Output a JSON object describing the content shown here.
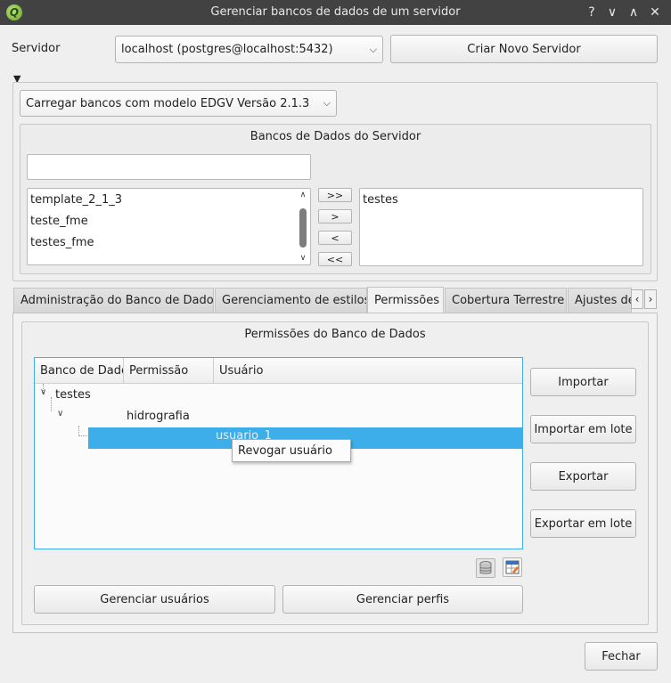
{
  "window": {
    "title": "Gerenciar bancos de dados de um servidor",
    "controls": [
      "?",
      "∨",
      "∧",
      "✕"
    ]
  },
  "server": {
    "label": "Servidor",
    "selected": "localhost (postgres@localhost:5432)",
    "create_button": "Criar Novo Servidor"
  },
  "template_combo": "Carregar bancos com modelo EDGV Versão 2.1.3",
  "server_dbs": {
    "title": "Bancos de Dados do Servidor",
    "filter_value": "",
    "available": [
      "template_2_1_3",
      "teste_fme",
      "testes_fme"
    ],
    "selected": [
      "testes"
    ],
    "move_buttons": [
      ">>",
      ">",
      "<",
      "<<"
    ]
  },
  "tabs": [
    {
      "label": "Administração do Banco de Dados"
    },
    {
      "label": "Gerenciamento de estilos"
    },
    {
      "label": "Permissões",
      "active": true
    },
    {
      "label": "Cobertura Terrestre"
    },
    {
      "label": "Ajustes de e"
    }
  ],
  "permissions": {
    "title": "Permissões do Banco de Dados",
    "columns": [
      "Banco de Dados",
      "Permissão",
      "Usuário"
    ],
    "tree": {
      "db": "testes",
      "permission": "hidrografia",
      "user": "usuario_1"
    },
    "context_menu": "Revogar usuário",
    "side_buttons": [
      "Importar",
      "Importar em lote",
      "Exportar",
      "Exportar em lote"
    ],
    "manage_users": "Gerenciar usuários",
    "manage_profiles": "Gerenciar perfis"
  },
  "close_button": "Fechar"
}
